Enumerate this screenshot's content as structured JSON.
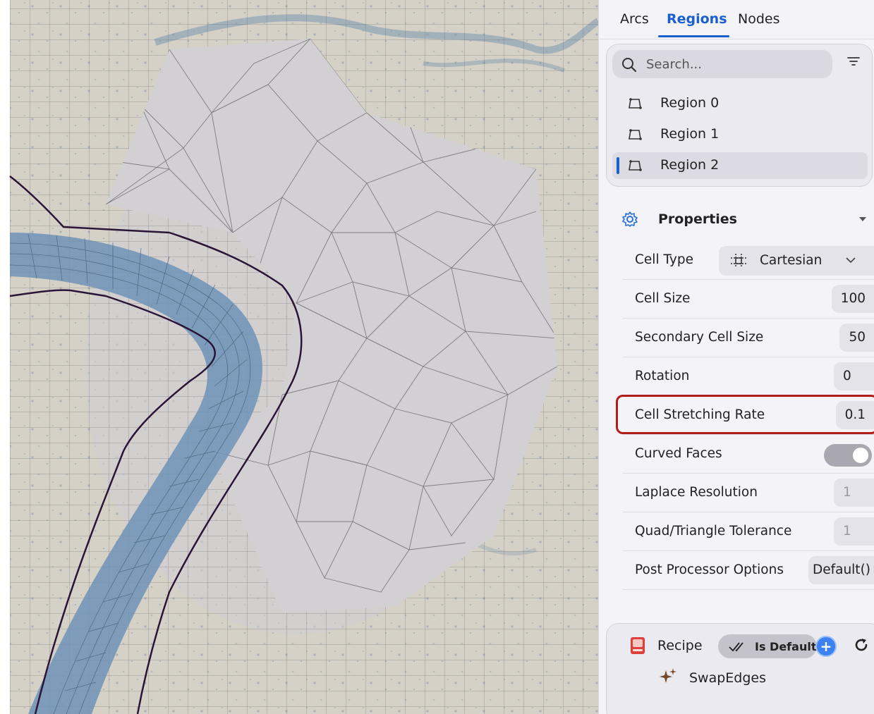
{
  "tabs": [
    {
      "label": "Arcs",
      "active": false
    },
    {
      "label": "Regions",
      "active": true
    },
    {
      "label": "Nodes",
      "active": false
    }
  ],
  "search": {
    "placeholder": "Search..."
  },
  "regions": [
    {
      "label": "Region 0",
      "selected": false
    },
    {
      "label": "Region 1",
      "selected": false
    },
    {
      "label": "Region 2",
      "selected": true
    }
  ],
  "properties": {
    "title": "Properties",
    "cell_type": {
      "label": "Cell Type",
      "value": "Cartesian"
    },
    "cell_size": {
      "label": "Cell Size",
      "value": "100"
    },
    "secondary_cell_size": {
      "label": "Secondary Cell Size",
      "value": "50"
    },
    "rotation": {
      "label": "Rotation",
      "value": "0"
    },
    "cell_stretching_rate": {
      "label": "Cell Stretching Rate",
      "value": "0.1",
      "highlighted": true
    },
    "curved_faces": {
      "label": "Curved Faces",
      "enabled": true
    },
    "laplace_resolution": {
      "label": "Laplace Resolution",
      "value": "1"
    },
    "quad_triangle_tolerance": {
      "label": "Quad/Triangle Tolerance",
      "value": "1"
    },
    "post_processor_options": {
      "label": "Post Processor Options",
      "value": "Default()"
    }
  },
  "recipe": {
    "label": "Recipe",
    "default_badge": "Is Default",
    "steps": [
      {
        "label": "SwapEdges"
      }
    ]
  },
  "colors": {
    "accent": "#1a5fd0",
    "highlight_border": "#b01c1c",
    "river": "#6f93b7",
    "boundary_line": "#2a1538",
    "mesh_line": "#6f6e72"
  },
  "icons": {
    "search": "search-icon",
    "filter": "filter-icon",
    "region": "polygon-region-icon",
    "properties": "gear-icon",
    "collapse": "caret-down-icon",
    "cell_type": "cartesian-grid-icon",
    "dropdown": "chevron-down-icon",
    "recipe": "recipe-book-icon",
    "default_check": "double-check-icon",
    "add": "plus-circle-icon",
    "refresh": "refresh-icon",
    "step": "sparkle-icon"
  }
}
